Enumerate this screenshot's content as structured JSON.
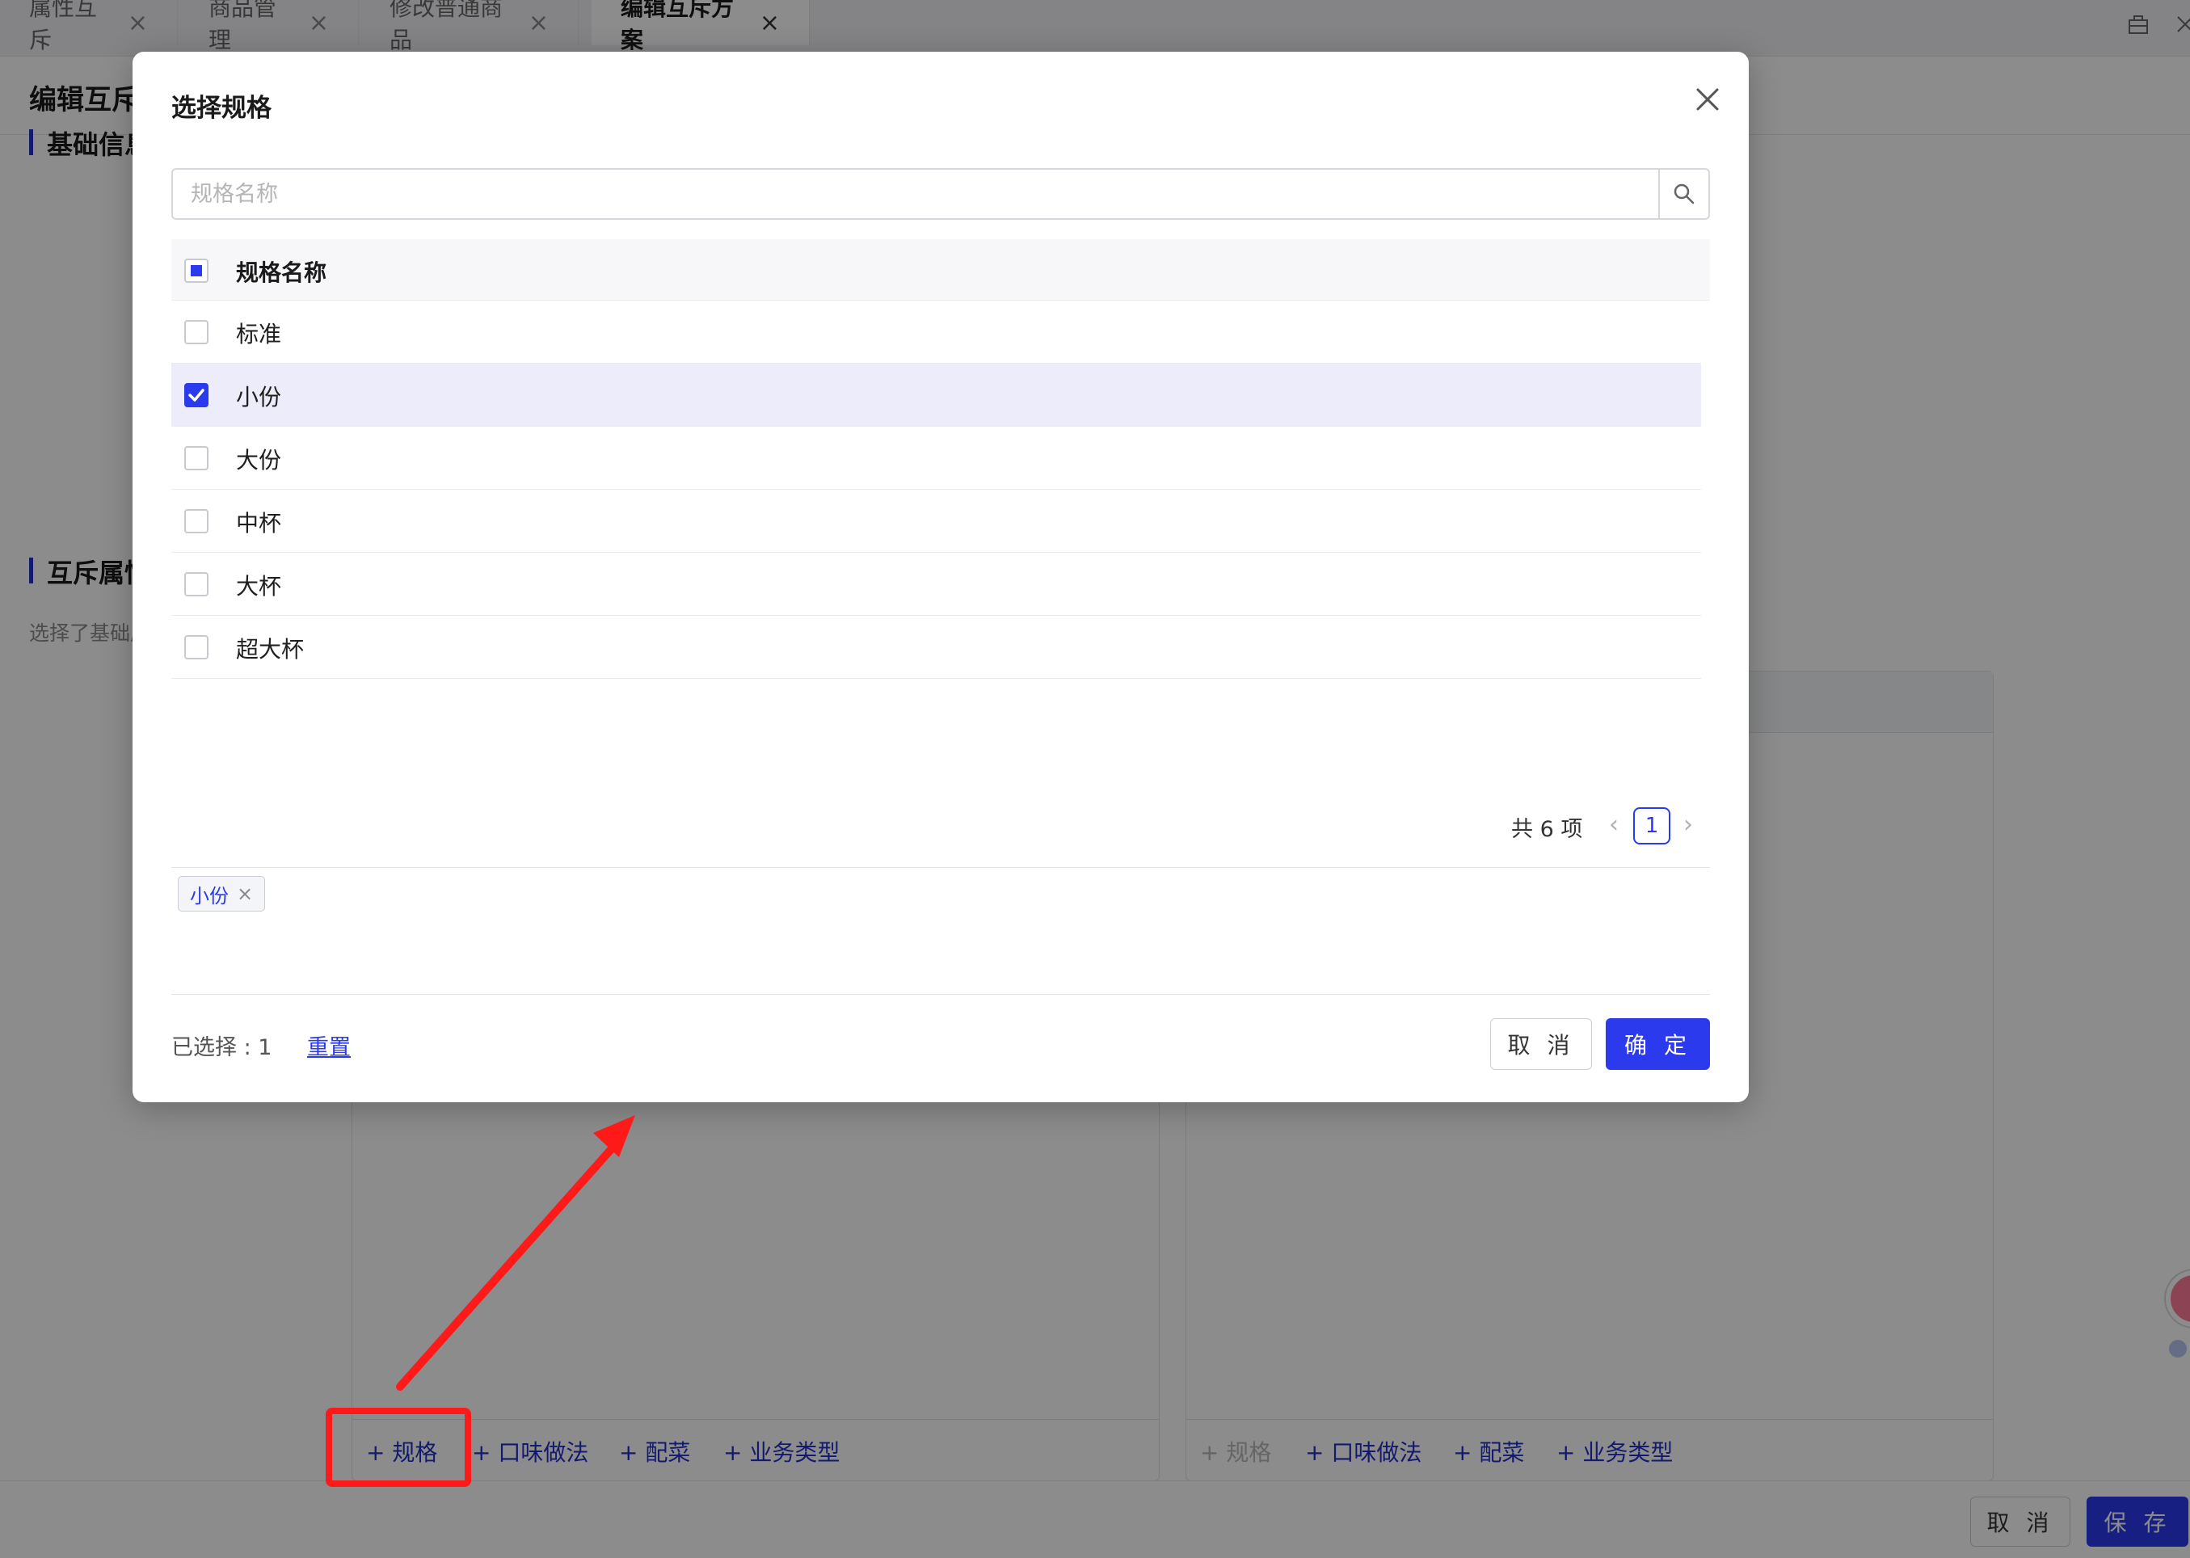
{
  "tabs": [
    {
      "label": "属性互斥",
      "close": "×"
    },
    {
      "label": "商品管理",
      "close": "×"
    },
    {
      "label": "修改普通商品",
      "close": "×"
    },
    {
      "label": "编辑互斥方案",
      "close": "×"
    }
  ],
  "page": {
    "title": "编辑互斥",
    "section_basic": "基础信息",
    "section_attr": "互斥属性",
    "section_desc": "选择了基础属"
  },
  "panels": {
    "left_links": [
      "+ 规格",
      "+ 口味做法",
      "+ 配菜",
      "+ 业务类型"
    ],
    "right_links": [
      "+ 规格",
      "+ 口味做法",
      "+ 配菜",
      "+ 业务类型"
    ]
  },
  "page_footer": {
    "cancel": "取 消",
    "save": "保 存"
  },
  "modal": {
    "title": "选择规格",
    "search_placeholder": "规格名称",
    "column_header": "规格名称",
    "rows": [
      {
        "name": "标准",
        "checked": false
      },
      {
        "name": "小份",
        "checked": true
      },
      {
        "name": "大份",
        "checked": false
      },
      {
        "name": "中杯",
        "checked": false
      },
      {
        "name": "大杯",
        "checked": false
      },
      {
        "name": "超大杯",
        "checked": false
      }
    ],
    "pagination": {
      "total_text": "共 6 项",
      "current_page": "1",
      "prev": "‹",
      "next": "›"
    },
    "selected_tags": [
      {
        "label": "小份",
        "close": "×"
      }
    ],
    "selected_count_text": "已选择 : 1",
    "reset_label": "重置",
    "cancel_label": "取 消",
    "confirm_label": "确 定"
  },
  "colors": {
    "primary": "#2b3aed",
    "selected_row": "#ececfb",
    "annotation": "#ff1a1a"
  },
  "icons": [
    "close-icon",
    "search-icon",
    "checkbox-checked-icon",
    "chevron-left-icon",
    "chevron-right-icon",
    "toolbar-icon"
  ]
}
